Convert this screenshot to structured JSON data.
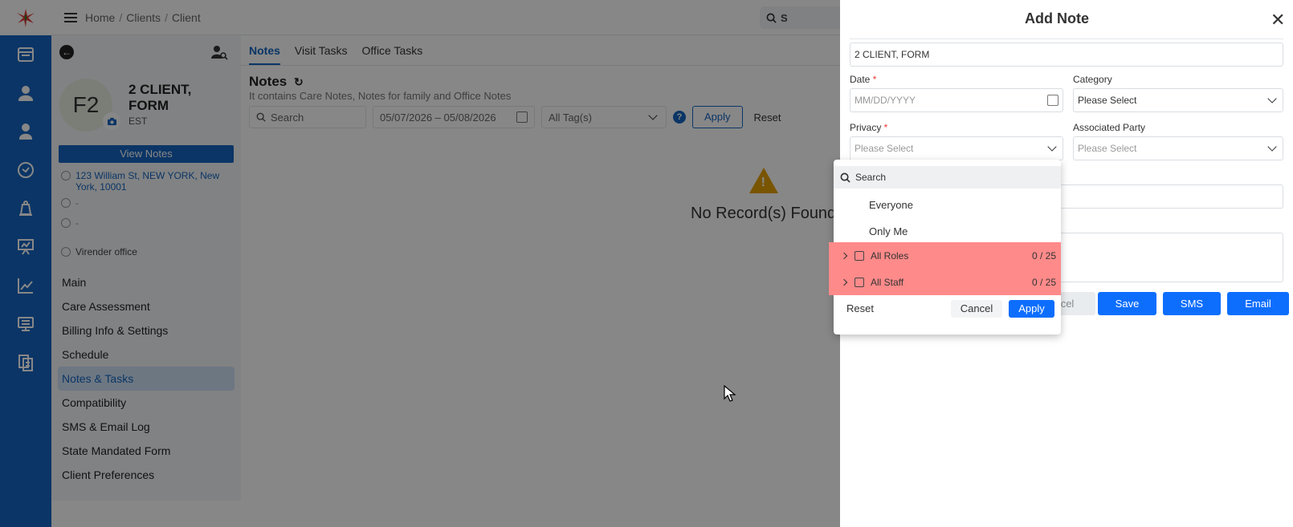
{
  "colors": {
    "primary": "#1565c0",
    "accent_button": "#0d6efd",
    "highlight": "#ff8a8a",
    "warning": "#e5a100"
  },
  "rail": {
    "icons": [
      "dashboard-icon",
      "clients-icon",
      "caregiver-icon",
      "clock-icon",
      "bell-icon",
      "presentation-icon",
      "chart-icon",
      "monitor-icon",
      "documents-icon"
    ]
  },
  "breadcrumb": {
    "home": "Home",
    "clients": "Clients",
    "client": "Client"
  },
  "topbar": {
    "search_text": "S"
  },
  "client": {
    "initials": "F2",
    "name": "2 CLIENT, FORM",
    "timezone": "EST",
    "view_notes": "View Notes",
    "address": "123 William St, NEW YORK, New York, 10001",
    "email": "-",
    "phone": "-",
    "office": "Virender office",
    "menu": [
      "Main",
      "Care Assessment",
      "Billing Info & Settings",
      "Schedule",
      "Notes & Tasks",
      "Compatibility",
      "SMS & Email Log",
      "State Mandated Form",
      "Client Preferences"
    ]
  },
  "tabs": [
    "Notes",
    "Visit Tasks",
    "Office Tasks"
  ],
  "notes": {
    "title": "Notes",
    "subtitle": "It contains Care Notes, Notes for family and Office Notes",
    "search_placeholder": "Search",
    "date_range": "05/07/2026 – 05/08/2026",
    "tags": "All Tag(s)",
    "apply": "Apply",
    "reset": "Reset",
    "empty": "No Record(s) Found"
  },
  "add_note": {
    "title": "Add Note",
    "client_field": "2 CLIENT, FORM",
    "date_label": "Date",
    "date_placeholder": "MM/DD/YYYY",
    "category_label": "Category",
    "category_value": "Please Select",
    "privacy_label": "Privacy",
    "privacy_value": "Please Select",
    "associated_label": "Associated Party",
    "associated_value": "Please Select",
    "cancel_partial": "cel",
    "save": "Save",
    "sms": "SMS",
    "email": "Email"
  },
  "privacy_dropdown": {
    "search_placeholder": "Search",
    "options": [
      "Everyone",
      "Only Me"
    ],
    "groups": [
      {
        "label": "All Roles",
        "count": "0 / 25"
      },
      {
        "label": "All Staff",
        "count": "0 / 25"
      }
    ],
    "reset": "Reset",
    "cancel": "Cancel",
    "apply": "Apply"
  }
}
